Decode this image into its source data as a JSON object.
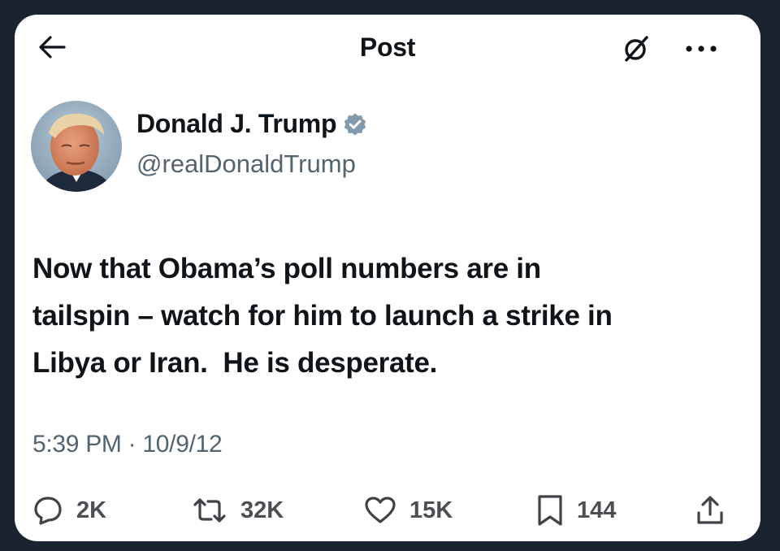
{
  "header": {
    "title": "Post",
    "back_icon": "arrow-left-icon",
    "grok_icon": "grok-icon",
    "more_icon": "more-horizontal-icon"
  },
  "author": {
    "name": "Donald J. Trump",
    "handle": "@realDonaldTrump",
    "verified": true,
    "verified_color": "#829aab"
  },
  "post": {
    "lines": [
      "Now that Obama’s poll numbers are in",
      "tailspin – watch for him to launch a strike in",
      "Libya or Iran.  He is desperate."
    ],
    "timestamp": "5:39 PM · 10/9/12"
  },
  "actions": {
    "replies": "2K",
    "reposts": "32K",
    "likes": "15K",
    "bookmarks": "144"
  },
  "colors": {
    "background": "#1a2330",
    "card": "#ffffff",
    "text": "#0f1419",
    "secondary": "#536471"
  }
}
